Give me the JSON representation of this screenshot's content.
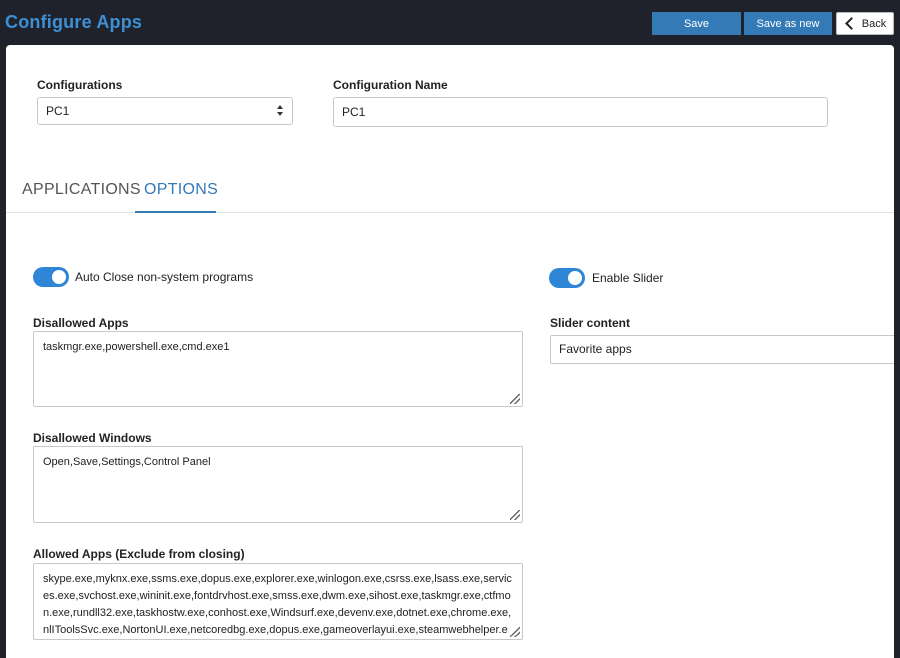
{
  "header": {
    "title": "Configure Apps",
    "save_label": "Save",
    "save_as_new_label": "Save as new",
    "back_label": "Back"
  },
  "config": {
    "configurations_label": "Configurations",
    "configurations_value": "PC1",
    "name_label": "Configuration Name",
    "name_value": "PC1"
  },
  "tabs": [
    {
      "label": "APPLICATIONS",
      "active": false
    },
    {
      "label": "OPTIONS",
      "active": true
    }
  ],
  "options": {
    "auto_close": {
      "label": "Auto Close non-system programs",
      "enabled": true
    },
    "enable_slider": {
      "label": "Enable Slider",
      "enabled": true
    },
    "disallowed_apps": {
      "label": "Disallowed Apps",
      "value": "taskmgr.exe,powershell.exe,cmd.exe1"
    },
    "disallowed_windows": {
      "label": "Disallowed Windows",
      "value": "Open,Save,Settings,Control Panel"
    },
    "allowed_apps": {
      "label": "Allowed Apps (Exclude from closing)",
      "value": "skype.exe,myknx.exe,ssms.exe,dopus.exe,explorer.exe,winlogon.exe,csrss.exe,lsass.exe,services.exe,svchost.exe,wininit.exe,fontdrvhost.exe,smss.exe,dwm.exe,sihost.exe,taskmgr.exe,ctfmon.exe,rundll32.exe,taskhostw.exe,conhost.exe,Windsurf.exe,devenv.exe,dotnet.exe,chrome.exe,nlIToolsSvc.exe,NortonUI.exe,netcoredbg.exe,dopus.exe,gameoverlayui.exe,steamwebhelper.exe,steam.exe,epicgameslauncher.exe"
    },
    "slider_content": {
      "label": "Slider content",
      "value": "Favorite apps"
    }
  },
  "colors": {
    "accent": "#337ab7",
    "toggle_on": "#2f86d6",
    "title": "#3d8fd6",
    "background": "#1f222b"
  }
}
